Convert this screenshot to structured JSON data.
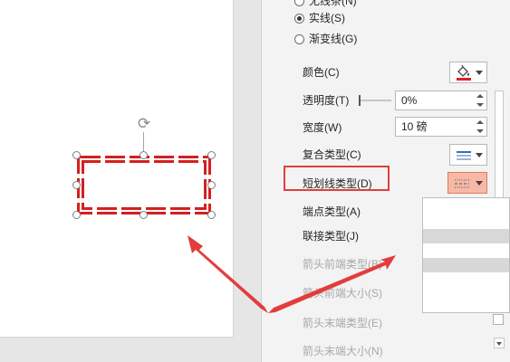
{
  "pane": {
    "line_options": {
      "no_line": "无线条(N)",
      "solid_line": "实线(S)",
      "gradient_line": "渐变线(G)",
      "selected": "solid_line"
    },
    "color": {
      "label": "颜色(C)",
      "value_color": "#e02020"
    },
    "transparency": {
      "label": "透明度(T)",
      "value": "0%"
    },
    "width": {
      "label": "宽度(W)",
      "value": "10 磅"
    },
    "compound_type": {
      "label": "复合类型(C)"
    },
    "dash_type": {
      "label": "短划线类型(D)"
    },
    "cap_type": {
      "label": "端点类型(A)"
    },
    "join_type": {
      "label": "联接类型(J)"
    },
    "begin_arrow_type": {
      "label": "箭头前端类型(B)"
    },
    "begin_arrow_size": {
      "label": "箭头前端大小(S)"
    },
    "end_arrow_type": {
      "label": "箭头末端类型(E)"
    },
    "end_arrow_size": {
      "label": "箭头末端大小(N)"
    }
  },
  "dash_options": [
    {
      "name": "solid",
      "selected": false
    },
    {
      "name": "round-dot",
      "selected": false
    },
    {
      "name": "square-dot",
      "selected": true
    },
    {
      "name": "dash",
      "selected": false
    },
    {
      "name": "dash-dot",
      "selected": false
    },
    {
      "name": "long-dash",
      "selected": false
    },
    {
      "name": "long-dash-dot",
      "selected": false
    },
    {
      "name": "long-dash-dot-dot",
      "selected": false
    }
  ],
  "colors": {
    "accent_red": "#e02020",
    "shape_line": "#d42020",
    "annotation": "#e23d3d"
  }
}
